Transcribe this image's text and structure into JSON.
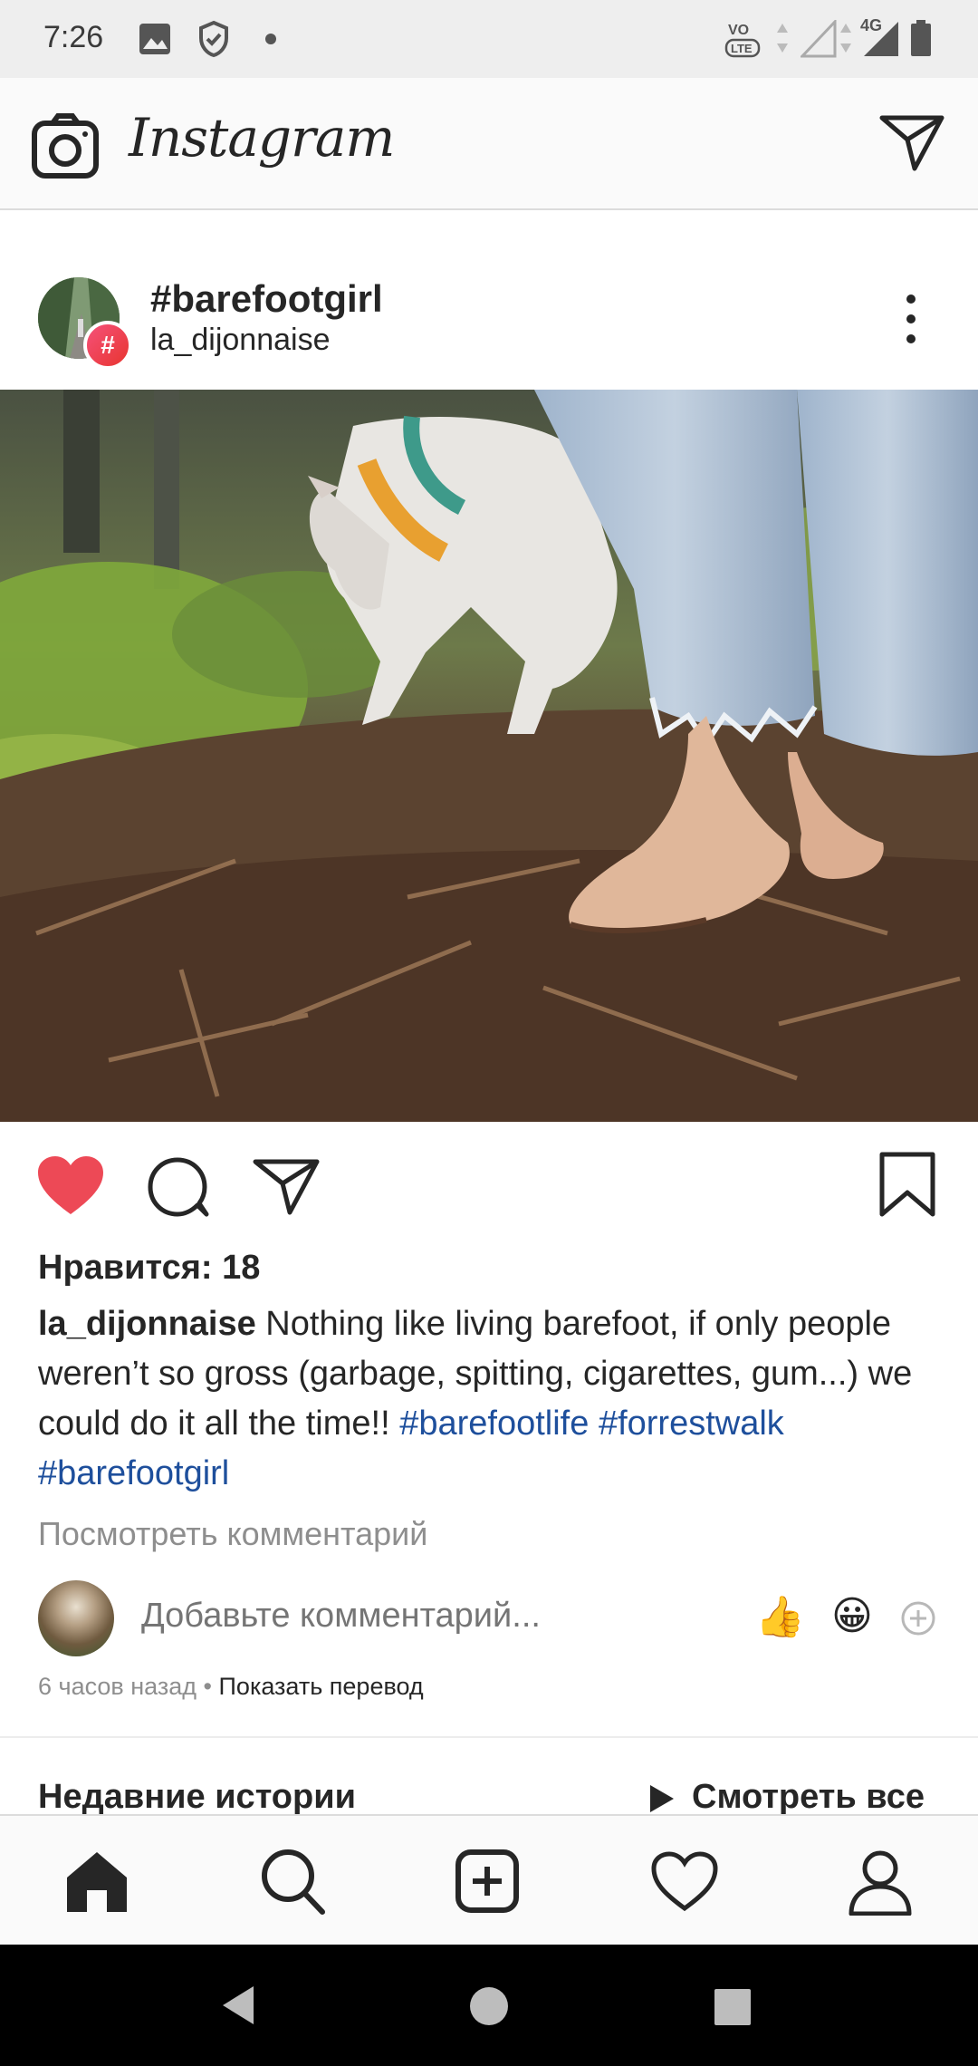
{
  "status_bar": {
    "time": "7:26",
    "icons": [
      "image-icon",
      "shield-icon",
      "dot-icon",
      "volte-icon",
      "wifi-signal-icon",
      "cell-signal-4g-icon",
      "battery-icon"
    ],
    "network_label": "4G",
    "volte_label": "VoLTE"
  },
  "header": {
    "logo_text": "Instagram",
    "left_icon": "camera-icon",
    "right_icon": "direct-message-icon"
  },
  "post": {
    "title": "#barefootgirl",
    "username": "la_dijonnaise",
    "badge": "#",
    "likes_text": "Нравится: 18",
    "caption_user": "la_dijonnaise",
    "caption_text": " Nothing like living barefoot, if only people weren’t so gross (garbage, spitting, cigarettes, gum...) we could do it all the time!! ",
    "hashtags": [
      "#barefootlife",
      "#forrestwalk",
      "#barefootgirl"
    ],
    "view_comments": "Посмотреть комментарий",
    "comment_placeholder": "Добавьте комментарий...",
    "quick_emojis": [
      "👍",
      "😀"
    ],
    "time_ago": "6 часов назад",
    "separator": " • ",
    "translate": "Показать перевод",
    "liked": true,
    "colors": {
      "like": "#ed4956",
      "hashtag": "#1e4f9c",
      "muted": "#8e8e8e"
    }
  },
  "stories": {
    "title": "Недавние истории",
    "see_all": "Смотреть все"
  },
  "bottom_nav": {
    "items": [
      "home-icon",
      "search-icon",
      "new-post-icon",
      "activity-heart-icon",
      "profile-icon"
    ]
  }
}
